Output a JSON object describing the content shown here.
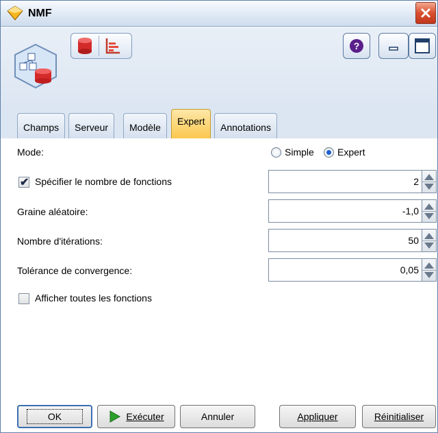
{
  "window": {
    "title": "NMF"
  },
  "tabs": [
    {
      "label": "Champs"
    },
    {
      "label": "Serveur"
    },
    {
      "label": "Modèle"
    },
    {
      "label": "Expert"
    },
    {
      "label": "Annotations"
    }
  ],
  "active_tab": "Expert",
  "form": {
    "mode_label": "Mode:",
    "mode_simple": "Simple",
    "mode_expert": "Expert",
    "mode_selected": "Expert",
    "num_features_label": "Spécifier le nombre de fonctions",
    "num_features_checked": true,
    "num_features_value": "2",
    "seed_label": "Graine aléatoire:",
    "seed_value": "-1,0",
    "iterations_label": "Nombre d'itérations:",
    "iterations_value": "50",
    "tolerance_label": "Tolérance de convergence:",
    "tolerance_value": "0,05",
    "show_all_label": "Afficher toutes les fonctions",
    "show_all_checked": false
  },
  "buttons": {
    "ok": "OK",
    "execute": "Exécuter",
    "cancel": "Annuler",
    "apply": "Appliquer",
    "reset": "Réinitialiser"
  },
  "colors": {
    "active_tab": "#fbc84f",
    "close_button": "#d9502f",
    "frame": "#dce6f2"
  },
  "icons": [
    "nmf-node-icon",
    "database-icon",
    "chart-icon",
    "help-icon",
    "minimize-icon",
    "maximize-icon",
    "close-icon",
    "play-icon"
  ]
}
